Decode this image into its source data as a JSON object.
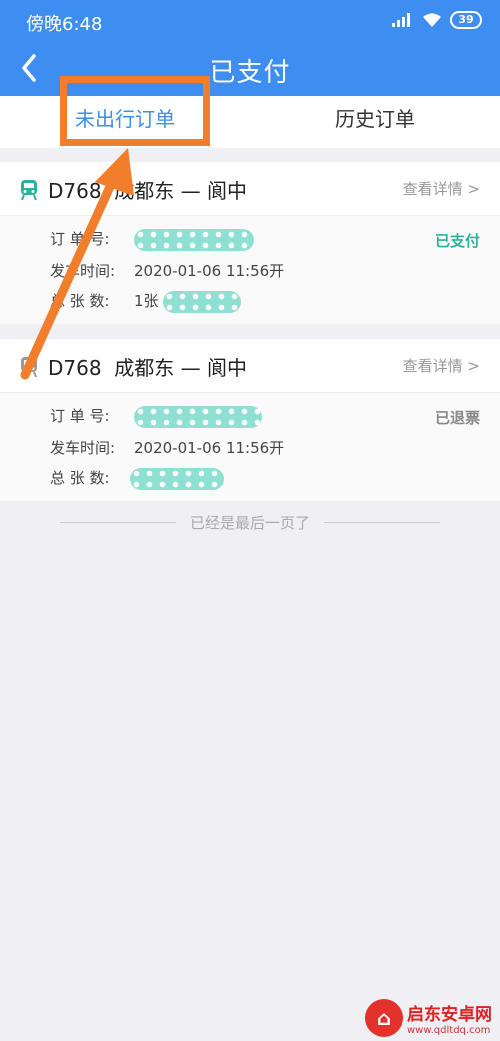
{
  "status_bar": {
    "time": "傍晚6:48",
    "battery": "39",
    "signal_icon": "signal-icon",
    "wifi_icon": "wifi-icon"
  },
  "header": {
    "title": "已支付",
    "back_icon": "back-arrow-icon"
  },
  "tabs": [
    {
      "label": "未出行订单",
      "active": true
    },
    {
      "label": "历史订单",
      "active": false
    }
  ],
  "orders": [
    {
      "train": "D768",
      "route": "成都东 — 阆中",
      "detail_link": "查看详情 >",
      "status": "已支付",
      "status_color": "#2bb39a",
      "icon_color": "#2bb39a",
      "labels": {
        "order_no": "订 单 号:",
        "depart": "发车时间:",
        "count": "总 张 数:"
      },
      "depart_time": "2020-01-06   11:56开",
      "ticket_count": "1张"
    },
    {
      "train": "D768",
      "route": "成都东 — 阆中",
      "detail_link": "查看详情 >",
      "status": "已退票",
      "status_color": "#888888",
      "icon_color": "#999999",
      "labels": {
        "order_no": "订 单 号:",
        "depart": "发车时间:",
        "count": "总 张 数:"
      },
      "depart_time": "2020-01-06   11:56开",
      "ticket_count": ""
    }
  ],
  "footer_text": "已经是最后一页了",
  "colors": {
    "primary": "#3d8ef0",
    "annotation": "#f27d2b"
  },
  "watermark": {
    "name": "启东安卓网",
    "url": "www.qdltdq.com"
  }
}
